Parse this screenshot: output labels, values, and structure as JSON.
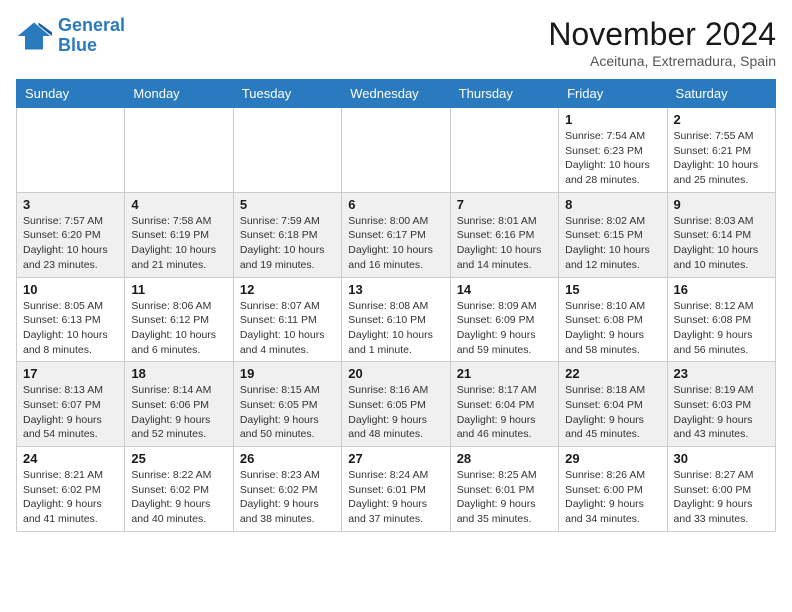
{
  "logo": {
    "line1": "General",
    "line2": "Blue"
  },
  "title": "November 2024",
  "location": "Aceituna, Extremadura, Spain",
  "weekdays": [
    "Sunday",
    "Monday",
    "Tuesday",
    "Wednesday",
    "Thursday",
    "Friday",
    "Saturday"
  ],
  "weeks": [
    [
      {
        "day": "",
        "info": ""
      },
      {
        "day": "",
        "info": ""
      },
      {
        "day": "",
        "info": ""
      },
      {
        "day": "",
        "info": ""
      },
      {
        "day": "",
        "info": ""
      },
      {
        "day": "1",
        "info": "Sunrise: 7:54 AM\nSunset: 6:23 PM\nDaylight: 10 hours and 28 minutes."
      },
      {
        "day": "2",
        "info": "Sunrise: 7:55 AM\nSunset: 6:21 PM\nDaylight: 10 hours and 25 minutes."
      }
    ],
    [
      {
        "day": "3",
        "info": "Sunrise: 7:57 AM\nSunset: 6:20 PM\nDaylight: 10 hours and 23 minutes."
      },
      {
        "day": "4",
        "info": "Sunrise: 7:58 AM\nSunset: 6:19 PM\nDaylight: 10 hours and 21 minutes."
      },
      {
        "day": "5",
        "info": "Sunrise: 7:59 AM\nSunset: 6:18 PM\nDaylight: 10 hours and 19 minutes."
      },
      {
        "day": "6",
        "info": "Sunrise: 8:00 AM\nSunset: 6:17 PM\nDaylight: 10 hours and 16 minutes."
      },
      {
        "day": "7",
        "info": "Sunrise: 8:01 AM\nSunset: 6:16 PM\nDaylight: 10 hours and 14 minutes."
      },
      {
        "day": "8",
        "info": "Sunrise: 8:02 AM\nSunset: 6:15 PM\nDaylight: 10 hours and 12 minutes."
      },
      {
        "day": "9",
        "info": "Sunrise: 8:03 AM\nSunset: 6:14 PM\nDaylight: 10 hours and 10 minutes."
      }
    ],
    [
      {
        "day": "10",
        "info": "Sunrise: 8:05 AM\nSunset: 6:13 PM\nDaylight: 10 hours and 8 minutes."
      },
      {
        "day": "11",
        "info": "Sunrise: 8:06 AM\nSunset: 6:12 PM\nDaylight: 10 hours and 6 minutes."
      },
      {
        "day": "12",
        "info": "Sunrise: 8:07 AM\nSunset: 6:11 PM\nDaylight: 10 hours and 4 minutes."
      },
      {
        "day": "13",
        "info": "Sunrise: 8:08 AM\nSunset: 6:10 PM\nDaylight: 10 hours and 1 minute."
      },
      {
        "day": "14",
        "info": "Sunrise: 8:09 AM\nSunset: 6:09 PM\nDaylight: 9 hours and 59 minutes."
      },
      {
        "day": "15",
        "info": "Sunrise: 8:10 AM\nSunset: 6:08 PM\nDaylight: 9 hours and 58 minutes."
      },
      {
        "day": "16",
        "info": "Sunrise: 8:12 AM\nSunset: 6:08 PM\nDaylight: 9 hours and 56 minutes."
      }
    ],
    [
      {
        "day": "17",
        "info": "Sunrise: 8:13 AM\nSunset: 6:07 PM\nDaylight: 9 hours and 54 minutes."
      },
      {
        "day": "18",
        "info": "Sunrise: 8:14 AM\nSunset: 6:06 PM\nDaylight: 9 hours and 52 minutes."
      },
      {
        "day": "19",
        "info": "Sunrise: 8:15 AM\nSunset: 6:05 PM\nDaylight: 9 hours and 50 minutes."
      },
      {
        "day": "20",
        "info": "Sunrise: 8:16 AM\nSunset: 6:05 PM\nDaylight: 9 hours and 48 minutes."
      },
      {
        "day": "21",
        "info": "Sunrise: 8:17 AM\nSunset: 6:04 PM\nDaylight: 9 hours and 46 minutes."
      },
      {
        "day": "22",
        "info": "Sunrise: 8:18 AM\nSunset: 6:04 PM\nDaylight: 9 hours and 45 minutes."
      },
      {
        "day": "23",
        "info": "Sunrise: 8:19 AM\nSunset: 6:03 PM\nDaylight: 9 hours and 43 minutes."
      }
    ],
    [
      {
        "day": "24",
        "info": "Sunrise: 8:21 AM\nSunset: 6:02 PM\nDaylight: 9 hours and 41 minutes."
      },
      {
        "day": "25",
        "info": "Sunrise: 8:22 AM\nSunset: 6:02 PM\nDaylight: 9 hours and 40 minutes."
      },
      {
        "day": "26",
        "info": "Sunrise: 8:23 AM\nSunset: 6:02 PM\nDaylight: 9 hours and 38 minutes."
      },
      {
        "day": "27",
        "info": "Sunrise: 8:24 AM\nSunset: 6:01 PM\nDaylight: 9 hours and 37 minutes."
      },
      {
        "day": "28",
        "info": "Sunrise: 8:25 AM\nSunset: 6:01 PM\nDaylight: 9 hours and 35 minutes."
      },
      {
        "day": "29",
        "info": "Sunrise: 8:26 AM\nSunset: 6:00 PM\nDaylight: 9 hours and 34 minutes."
      },
      {
        "day": "30",
        "info": "Sunrise: 8:27 AM\nSunset: 6:00 PM\nDaylight: 9 hours and 33 minutes."
      }
    ]
  ]
}
